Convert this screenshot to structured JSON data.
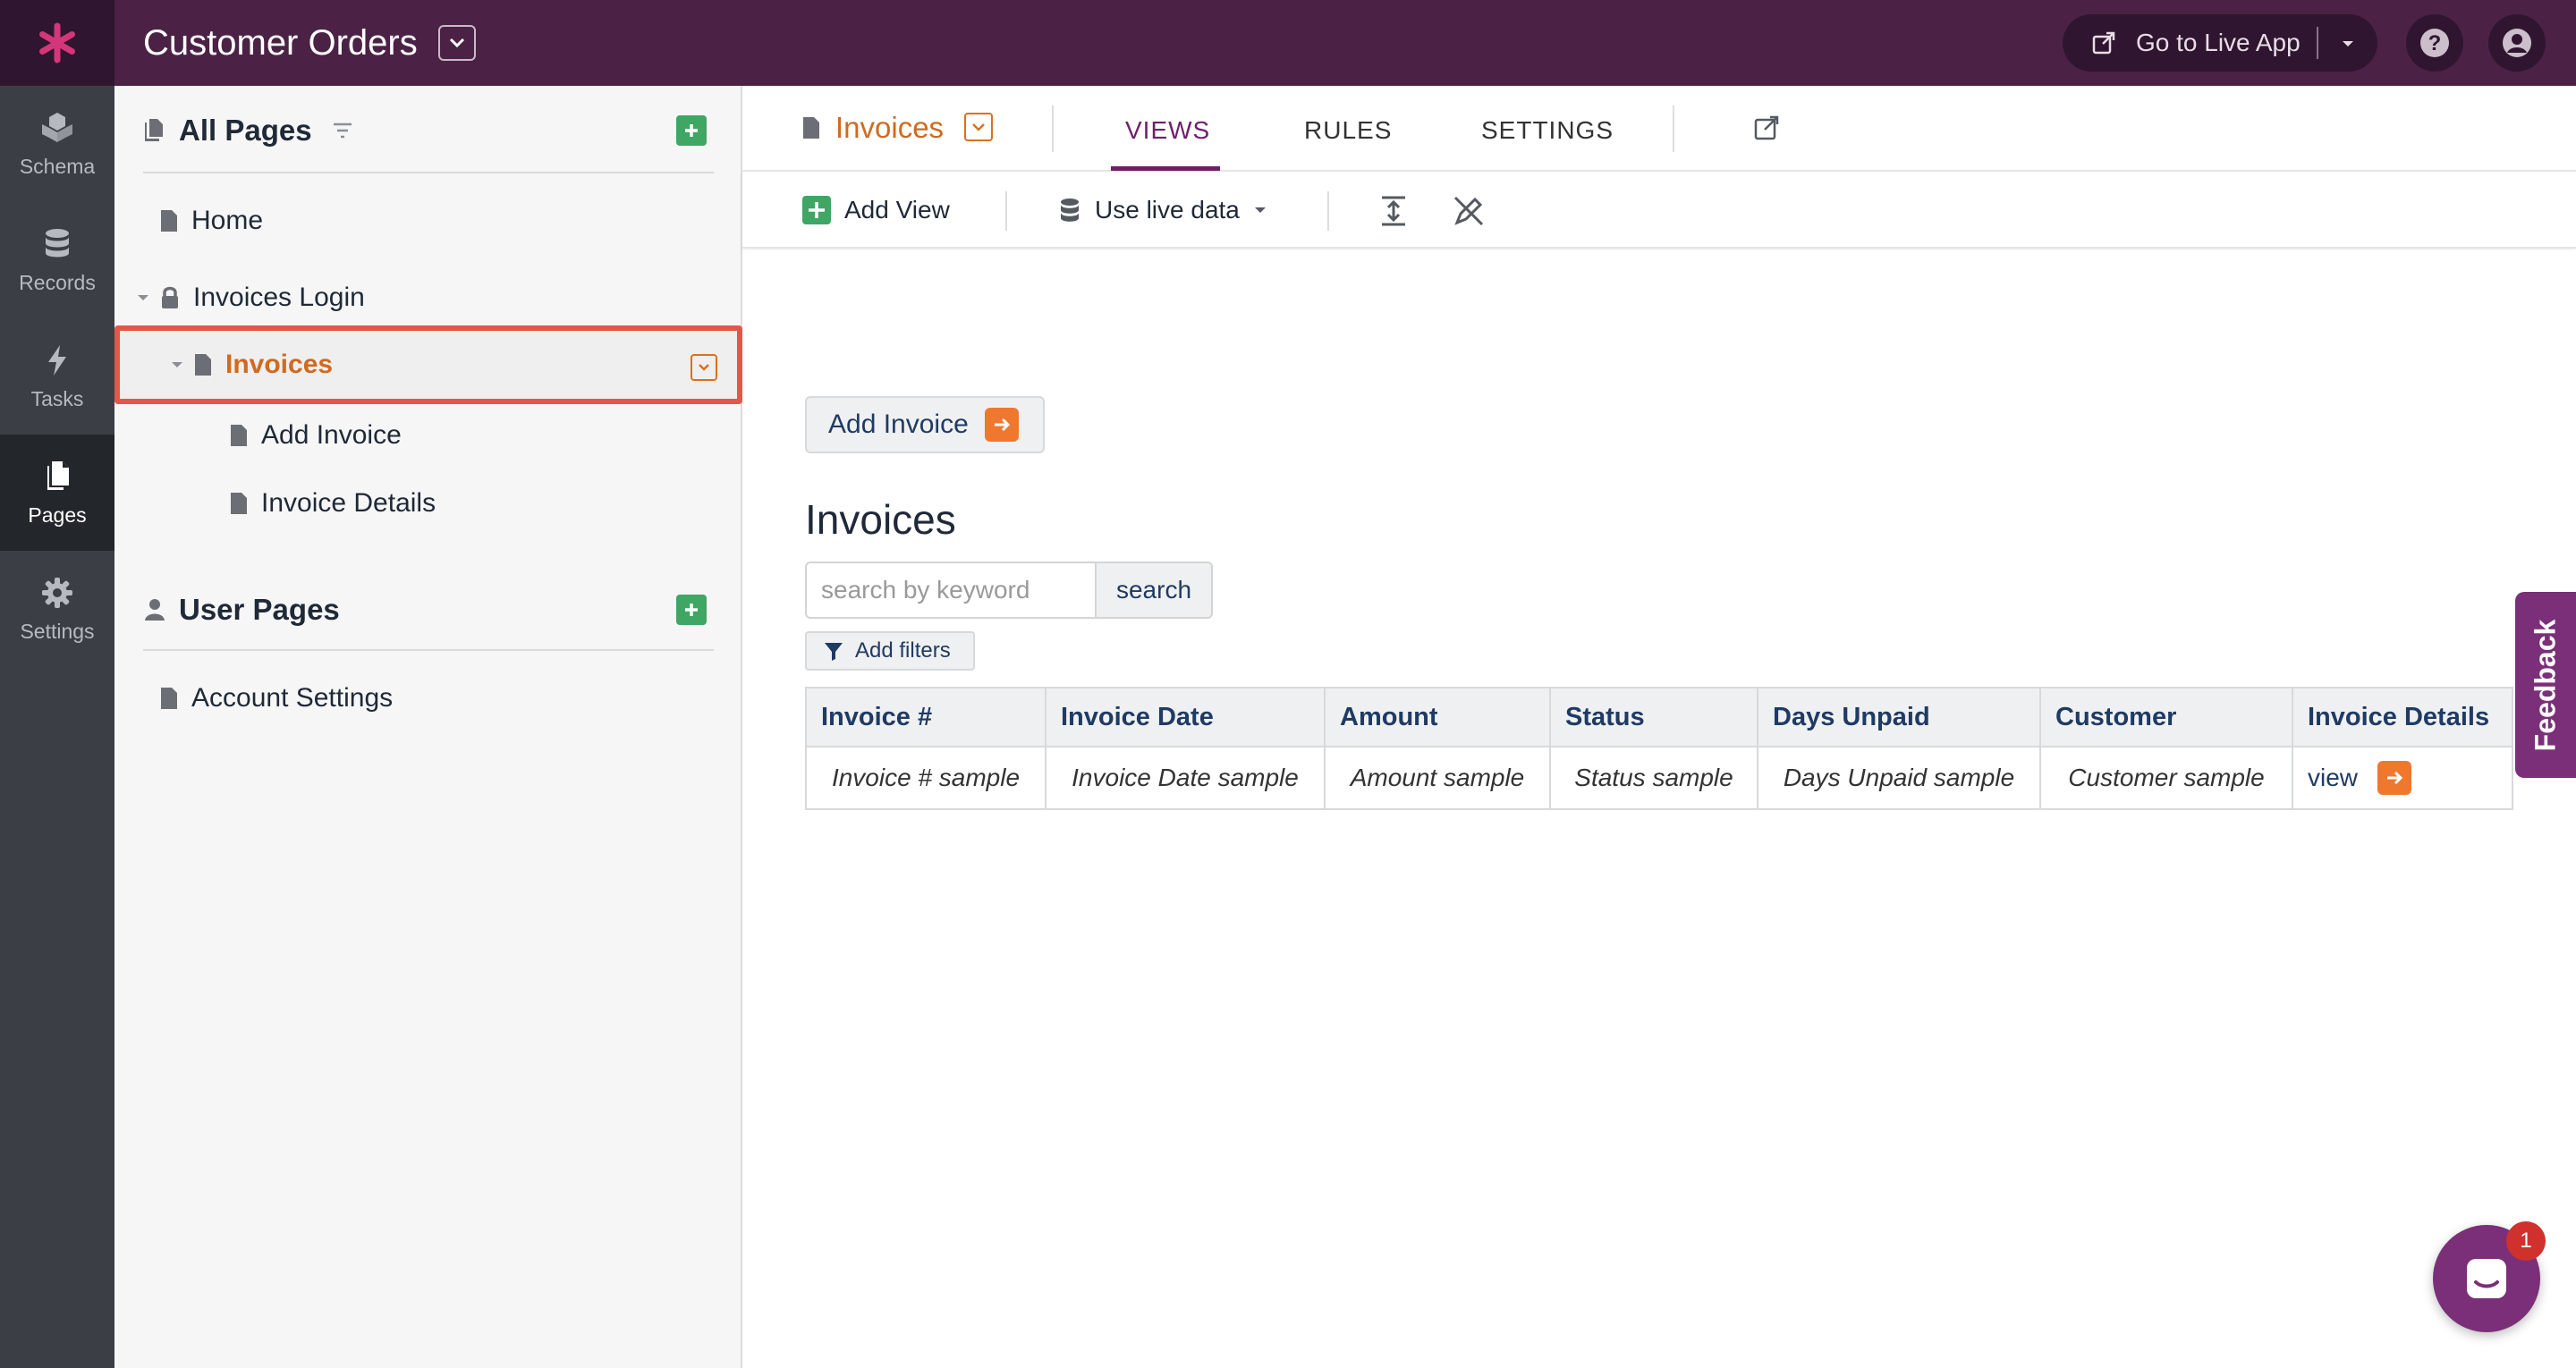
{
  "app": {
    "title": "Customer Orders",
    "go_live_label": "Go to Live App"
  },
  "rail": {
    "items": [
      {
        "label": "Schema",
        "icon": "cubes-icon"
      },
      {
        "label": "Records",
        "icon": "database-icon"
      },
      {
        "label": "Tasks",
        "icon": "bolt-icon"
      },
      {
        "label": "Pages",
        "icon": "pages-icon"
      },
      {
        "label": "Settings",
        "icon": "gear-icon"
      }
    ],
    "active": "Pages"
  },
  "pages_panel": {
    "all_pages_label": "All Pages",
    "items": {
      "home": "Home",
      "invoices_login": "Invoices Login",
      "invoices": "Invoices",
      "add_invoice": "Add Invoice",
      "invoice_details": "Invoice Details"
    },
    "user_pages_label": "User Pages",
    "user_items": {
      "account_settings": "Account Settings"
    }
  },
  "main": {
    "page_name": "Invoices",
    "tabs": {
      "views": "VIEWS",
      "rules": "RULES",
      "settings": "SETTINGS"
    },
    "active_tab": "VIEWS",
    "toolbar": {
      "add_view": "Add View",
      "live_data": "Use live data"
    }
  },
  "content": {
    "add_invoice_button": "Add Invoice",
    "heading": "Invoices",
    "search": {
      "placeholder": "search by keyword",
      "button": "search"
    },
    "filters_button": "Add filters",
    "table": {
      "columns": [
        "Invoice #",
        "Invoice Date",
        "Amount",
        "Status",
        "Days Unpaid",
        "Customer",
        "Invoice Details"
      ],
      "row": [
        "Invoice # sample",
        "Invoice Date sample",
        "Amount sample",
        "Status sample",
        "Days Unpaid sample",
        "Customer sample"
      ],
      "view_link": "view"
    }
  },
  "feedback_label": "Feedback",
  "chat_badge_count": "1",
  "colors": {
    "topbar": "#4b2246",
    "accent_orange": "#d06a1f",
    "accent_purple": "#6f1f6a",
    "selection_outline": "#e2574a",
    "add_green": "#3fa663"
  }
}
